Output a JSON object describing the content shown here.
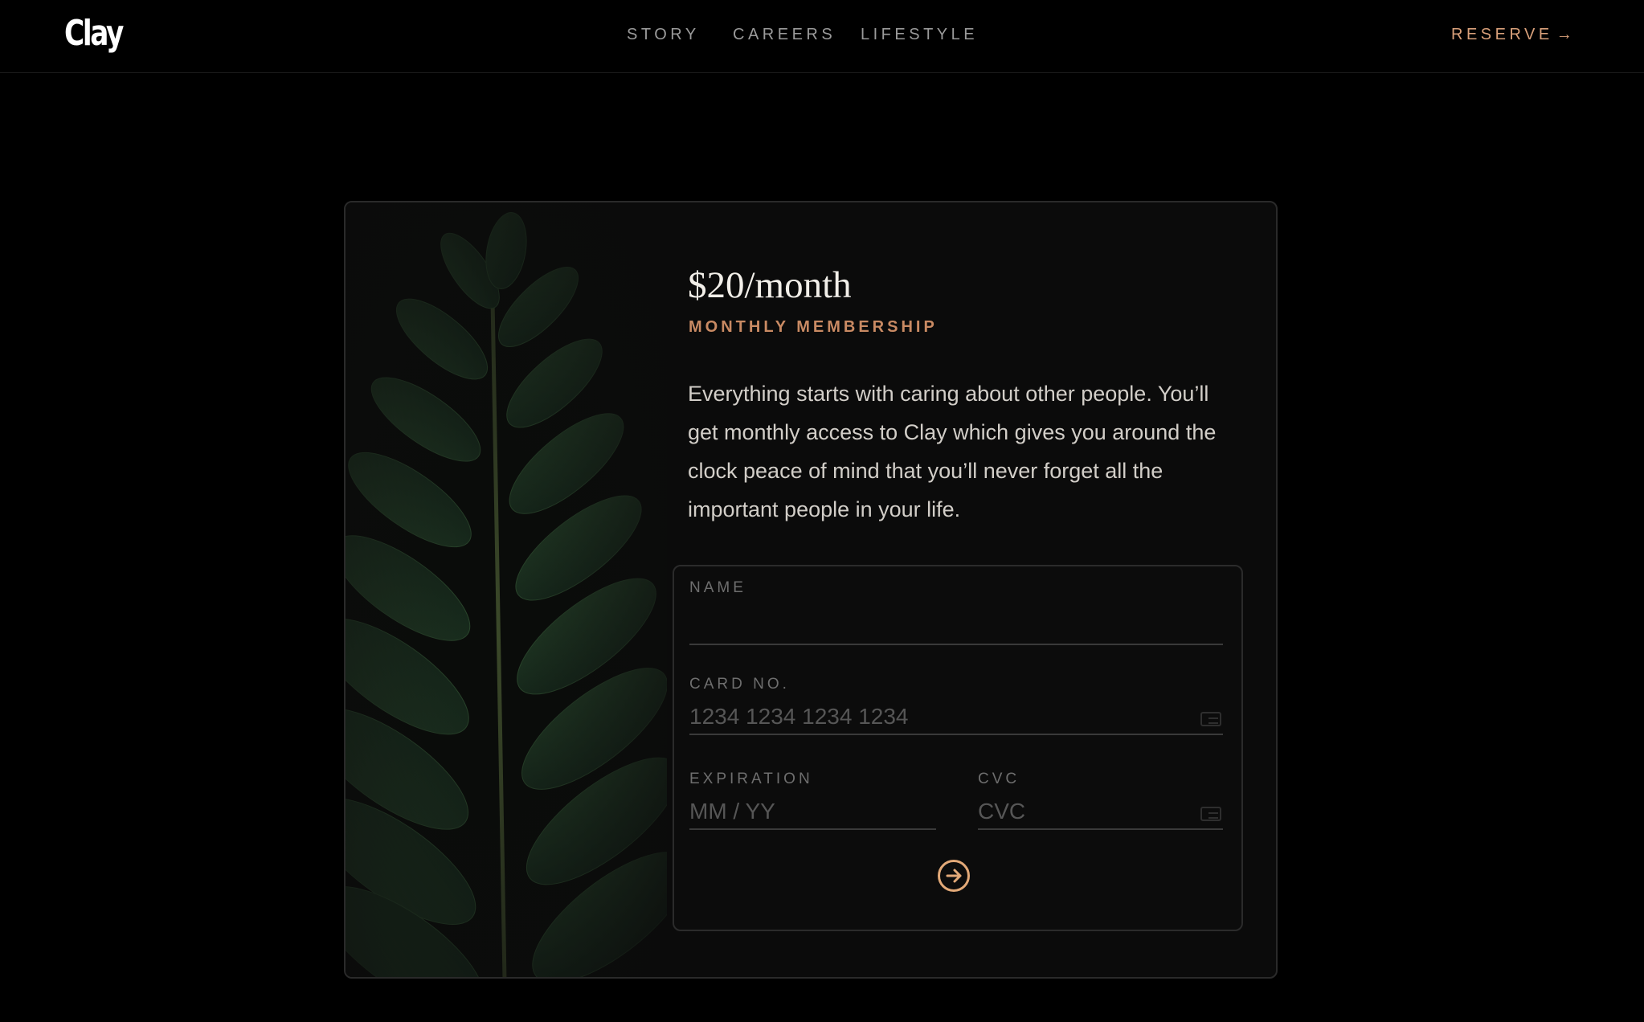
{
  "header": {
    "logo": "Clay",
    "nav": [
      {
        "label": "STORY"
      },
      {
        "label": "CAREERS"
      },
      {
        "label": "LIFESTYLE"
      }
    ],
    "reserve_label": "RESERVE",
    "reserve_icon": "arrow-right-icon"
  },
  "membership": {
    "price": "$20/month",
    "plan": "MONTHLY MEMBERSHIP",
    "description": "Everything starts with caring about other people. You’ll get monthly access to Clay which gives you around the clock peace of mind that you’ll never forget all the important people in your life."
  },
  "form": {
    "name_label": "NAME",
    "name_value": "",
    "card_label": "CARD NO.",
    "card_placeholder": "1234 1234 1234 1234",
    "expiration_label": "EXPIRATION",
    "expiration_placeholder": "MM / YY",
    "cvc_label": "CVC",
    "cvc_placeholder": "CVC",
    "submit_icon": "arrow-circle-right-icon"
  },
  "colors": {
    "background": "#000000",
    "accent": "#d9a07a",
    "card": "#0b0b0b",
    "leaf": "#1f3a1c"
  }
}
